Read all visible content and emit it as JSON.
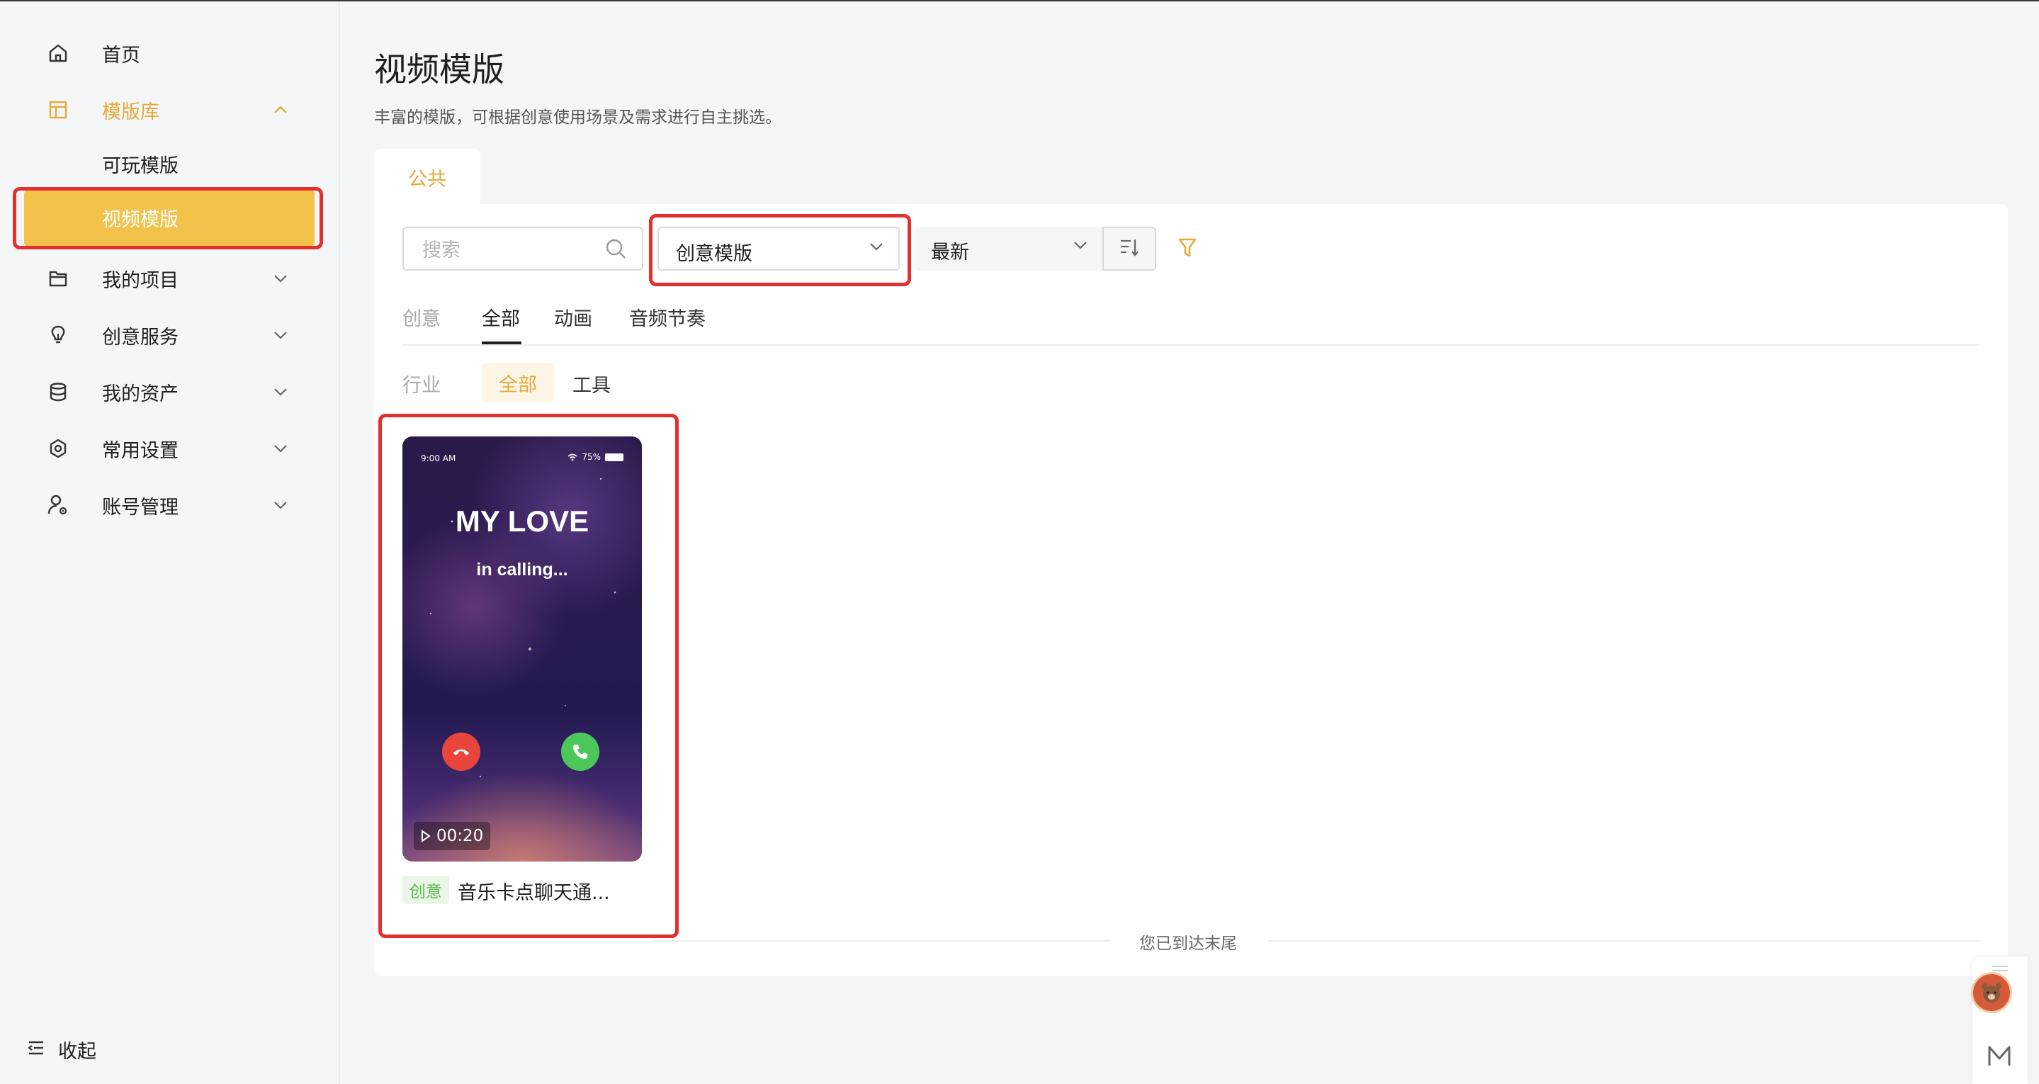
{
  "sidebar": {
    "items": [
      {
        "label": "首页",
        "icon": "home-icon"
      },
      {
        "label": "模版库",
        "icon": "template-icon"
      },
      {
        "label": "可玩模版"
      },
      {
        "label": "视频模版"
      },
      {
        "label": "我的项目",
        "icon": "folder-icon"
      },
      {
        "label": "创意服务",
        "icon": "lightbulb-icon"
      },
      {
        "label": "我的资产",
        "icon": "database-icon"
      },
      {
        "label": "常用设置",
        "icon": "settings-icon"
      },
      {
        "label": "账号管理",
        "icon": "user-gear-icon"
      }
    ],
    "collapse_label": "收起"
  },
  "header": {
    "title": "视频模版",
    "subtitle": "丰富的模版，可根据创意使用场景及需求进行自主挑选。"
  },
  "tabs": [
    {
      "label": "公共"
    }
  ],
  "toolbar": {
    "search_placeholder": "搜索",
    "template_type": "创意模版",
    "sort": "最新"
  },
  "filters": {
    "row1": {
      "label": "创意",
      "options": [
        "全部",
        "动画",
        "音频节奏"
      ],
      "selected": "全部"
    },
    "row2": {
      "label": "行业",
      "options": [
        "全部",
        "工具"
      ],
      "selected": "全部"
    }
  },
  "card": {
    "status_time": "9:00 AM",
    "status_battery": "75%",
    "phone_title": "MY LOVE",
    "phone_subtitle": "in calling...",
    "duration": "00:20",
    "tag": "创意",
    "title": "音乐卡点聊天通..."
  },
  "end_text": "您已到达末尾",
  "colors": {
    "accent": "#e8a93a",
    "selected_bg": "#f2c24a",
    "highlight": "#e2302e",
    "tag_green": "#5bb84a"
  }
}
